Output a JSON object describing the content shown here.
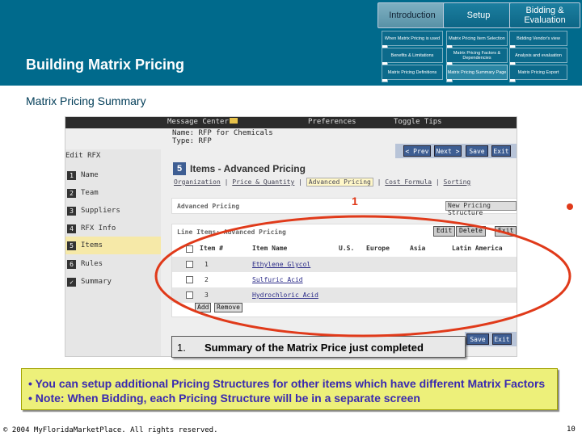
{
  "banner": {
    "title": "Building Matrix Pricing",
    "phases": [
      {
        "label": "Introduction"
      },
      {
        "label": "Setup"
      },
      {
        "label": "Bidding & Evaluation"
      }
    ],
    "subnav": [
      {
        "label": "When Matrix Pricing is used",
        "active": false
      },
      {
        "label": "Matrix Pricing Item Selection",
        "active": false
      },
      {
        "label": "Bidding Vendor's view",
        "active": false
      },
      {
        "label": "Benefits & Limitations",
        "active": false
      },
      {
        "label": "Matrix Pricing Factors & Dependencies",
        "active": false
      },
      {
        "label": "Analysis and evaluation",
        "active": false
      },
      {
        "label": "Matrix Pricing Definitions",
        "active": false
      },
      {
        "label": "Matrix Pricing Summary Page",
        "active": true
      },
      {
        "label": "Matrix Pricing Export",
        "active": false
      }
    ]
  },
  "section_title": "Matrix Pricing Summary",
  "screenshot": {
    "top_links": [
      "Message Center",
      "Preferences",
      "Toggle Tips"
    ],
    "name_line": "Name: RFP for Chemicals",
    "type_line": "Type: RFP",
    "nav_heading": "Edit RFX",
    "nav": [
      {
        "num": "1",
        "label": "Name"
      },
      {
        "num": "2",
        "label": "Team"
      },
      {
        "num": "3",
        "label": "Suppliers"
      },
      {
        "num": "4",
        "label": "RFX Info"
      },
      {
        "num": "5",
        "label": "Items"
      },
      {
        "num": "6",
        "label": "Rules"
      },
      {
        "num": "✓",
        "label": "Summary"
      }
    ],
    "toolbar": [
      "< Prev",
      "Next >",
      "Save",
      "Exit"
    ],
    "step_number": "5",
    "step_title": "Items - Advanced Pricing",
    "tabs": [
      "Organization",
      "Price & Quantity",
      "Advanced Pricing",
      "Cost Formula",
      "Sorting"
    ],
    "advanced_label": "Advanced Pricing",
    "new_structure": "New Pricing Structure",
    "callout_number": "1",
    "table_title": "Line Items: Advanced Pricing",
    "table_buttons": [
      "Edit",
      "Delete",
      "Exit"
    ],
    "columns": [
      "Item #",
      "Item Name",
      "U.S.",
      "Europe",
      "Asia",
      "Latin America"
    ],
    "rows": [
      {
        "num": "1",
        "name": "Ethylene Glycol"
      },
      {
        "num": "2",
        "name": "Sulfuric Acid"
      },
      {
        "num": "3",
        "name": "Hydrochloric Acid"
      }
    ],
    "add_buttons": [
      "Add",
      "Remove"
    ],
    "bottom_buttons": [
      "Save",
      "Exit"
    ]
  },
  "caption": {
    "number": "1.",
    "text": "Summary of the Matrix Price just completed"
  },
  "bullets": [
    "•  You can setup additional Pricing Structures for other items which have different Matrix Factors",
    "•  Note: When Bidding, each Pricing Structure will be in a separate screen"
  ],
  "footer": "© 2004 MyFloridaMarketPlace. All rights reserved.",
  "page_number": "10",
  "colors": {
    "banner": "#006a8c",
    "highlight": "#e03a1a",
    "bullet_bg": "#edf07a",
    "bullet_text": "#3a2ab0"
  }
}
